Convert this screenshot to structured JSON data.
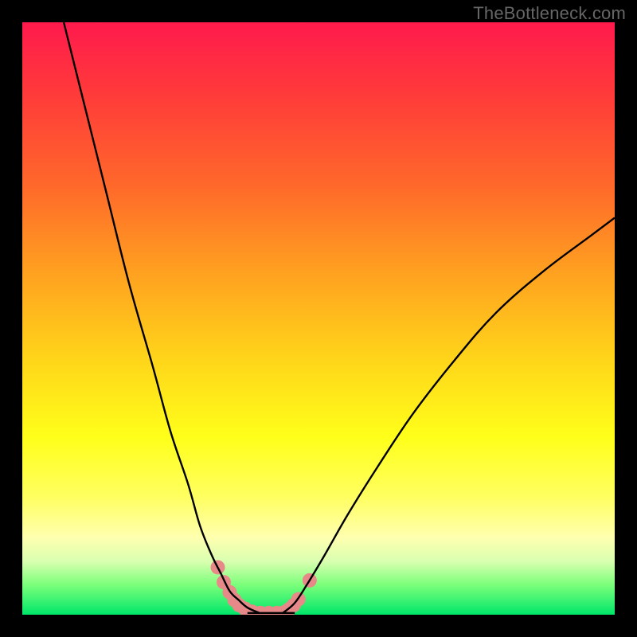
{
  "watermark": "TheBottleneck.com",
  "chart_data": {
    "type": "line",
    "title": "",
    "xlabel": "",
    "ylabel": "",
    "xlim": [
      0,
      100
    ],
    "ylim": [
      0,
      100
    ],
    "series": [
      {
        "name": "left-curve",
        "x": [
          7,
          10,
          14,
          18,
          22,
          25,
          28,
          30,
          32,
          33.5,
          35,
          36.5,
          38,
          40
        ],
        "y": [
          100,
          88,
          72,
          56,
          42,
          31,
          22,
          15,
          10,
          7,
          4,
          2.5,
          1.2,
          0.3
        ]
      },
      {
        "name": "right-curve",
        "x": [
          44,
          46,
          48,
          51,
          55,
          60,
          66,
          73,
          80,
          88,
          96,
          100
        ],
        "y": [
          0.3,
          2,
          5,
          10,
          17,
          25,
          34,
          43,
          51,
          58,
          64,
          67
        ]
      }
    ],
    "flat_bottom": {
      "x_start": 38,
      "x_end": 46,
      "y": 0.3
    },
    "markers": {
      "name": "salmon-markers",
      "color": "#e88989",
      "radius_px": 9,
      "points": [
        {
          "x": 33.0,
          "y": 8.0
        },
        {
          "x": 34.0,
          "y": 5.5
        },
        {
          "x": 35.0,
          "y": 3.8
        },
        {
          "x": 35.8,
          "y": 2.5
        },
        {
          "x": 36.6,
          "y": 1.6
        },
        {
          "x": 37.6,
          "y": 1.0
        },
        {
          "x": 38.8,
          "y": 0.5
        },
        {
          "x": 40.2,
          "y": 0.3
        },
        {
          "x": 41.6,
          "y": 0.3
        },
        {
          "x": 43.0,
          "y": 0.3
        },
        {
          "x": 44.2,
          "y": 0.4
        },
        {
          "x": 45.0,
          "y": 0.9
        },
        {
          "x": 45.8,
          "y": 1.6
        },
        {
          "x": 46.6,
          "y": 2.6
        },
        {
          "x": 48.5,
          "y": 5.8
        }
      ]
    },
    "colors": {
      "gradient_top": "#ff1a4d",
      "gradient_bottom": "#00e66a",
      "curve": "#000000",
      "marker": "#e88989",
      "frame": "#000000"
    }
  }
}
